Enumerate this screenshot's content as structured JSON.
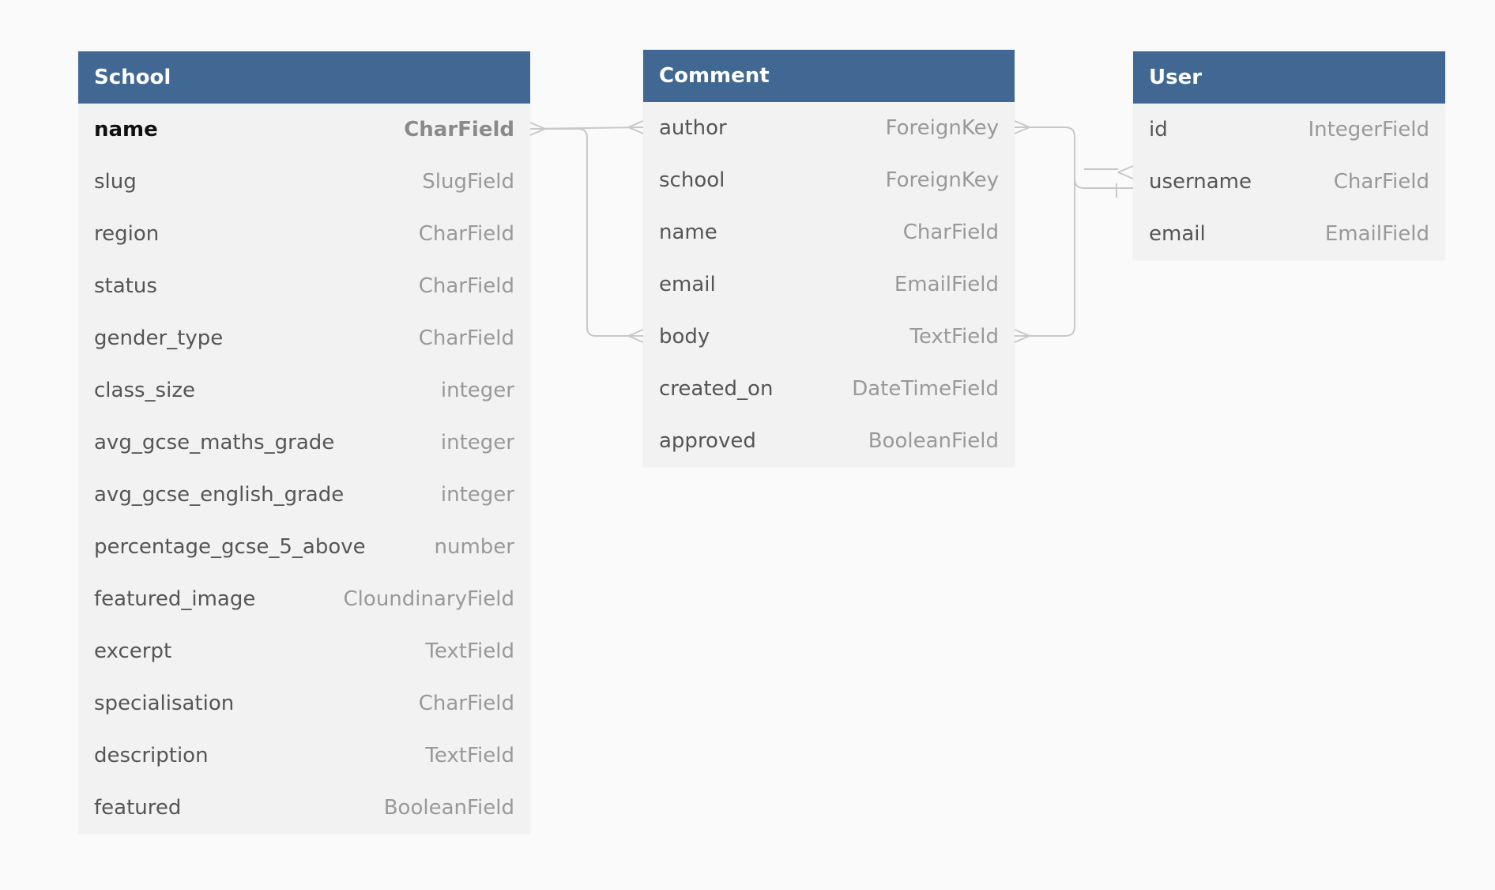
{
  "entities": {
    "school": {
      "title": "School",
      "fields": [
        {
          "name": "name",
          "type": "CharField",
          "pk": true
        },
        {
          "name": "slug",
          "type": "SlugField"
        },
        {
          "name": "region",
          "type": "CharField"
        },
        {
          "name": "status",
          "type": "CharField"
        },
        {
          "name": "gender_type",
          "type": "CharField"
        },
        {
          "name": "class_size",
          "type": "integer"
        },
        {
          "name": "avg_gcse_maths_grade",
          "type": "integer"
        },
        {
          "name": "avg_gcse_english_grade",
          "type": "integer"
        },
        {
          "name": "percentage_gcse_5_above",
          "type": "number"
        },
        {
          "name": "featured_image",
          "type": "CloundinaryField"
        },
        {
          "name": "excerpt",
          "type": "TextField"
        },
        {
          "name": "specialisation",
          "type": "CharField"
        },
        {
          "name": "description",
          "type": "TextField"
        },
        {
          "name": "featured",
          "type": "BooleanField"
        }
      ]
    },
    "comment": {
      "title": "Comment",
      "fields": [
        {
          "name": "author",
          "type": "ForeignKey"
        },
        {
          "name": "school",
          "type": "ForeignKey"
        },
        {
          "name": "name",
          "type": "CharField"
        },
        {
          "name": "email",
          "type": "EmailField"
        },
        {
          "name": "body",
          "type": "TextField"
        },
        {
          "name": "created_on",
          "type": "DateTimeField"
        },
        {
          "name": "approved",
          "type": "BooleanField"
        }
      ]
    },
    "user": {
      "title": "User",
      "fields": [
        {
          "name": "id",
          "type": "IntegerField"
        },
        {
          "name": "username",
          "type": "CharField"
        },
        {
          "name": "email",
          "type": "EmailField"
        }
      ]
    }
  },
  "relationships": [
    {
      "from": "School.name",
      "to": "Comment.author"
    },
    {
      "from": "School.name",
      "to": "Comment.body"
    },
    {
      "from": "Comment.author",
      "to": "User.username"
    },
    {
      "from": "Comment.body",
      "to": "User.username"
    }
  ],
  "colors": {
    "header": "#416892",
    "table_body": "#f2f2f2",
    "background": "#fafafa",
    "connector": "#c8c8c8"
  }
}
